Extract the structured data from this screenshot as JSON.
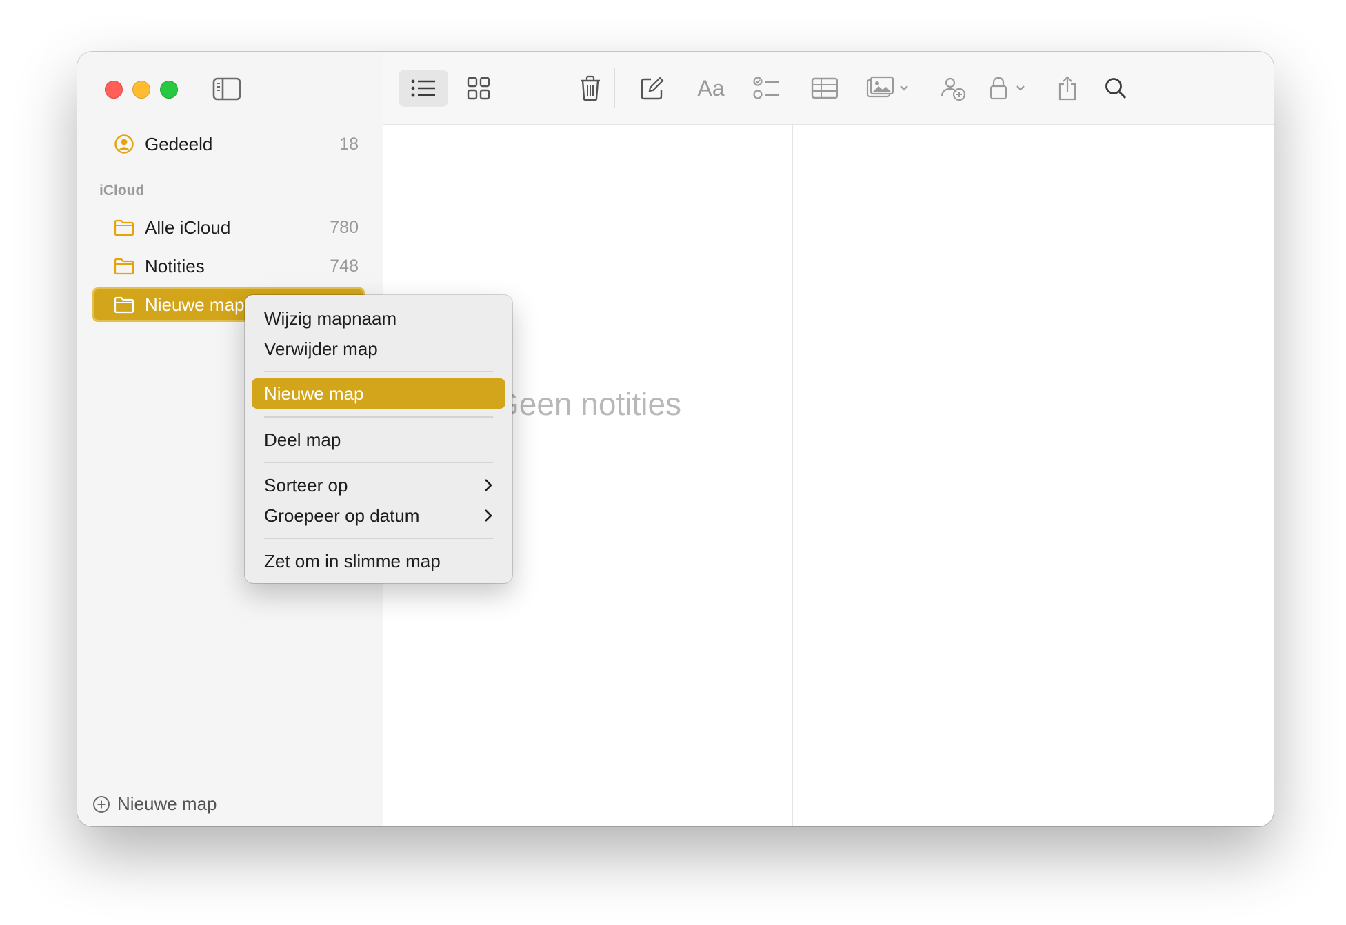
{
  "sidebar": {
    "shared": {
      "label": "Gedeeld",
      "count": "18"
    },
    "section_header": "iCloud",
    "folders": [
      {
        "label": "Alle iCloud",
        "count": "780"
      },
      {
        "label": "Notities",
        "count": "748"
      },
      {
        "label": "Nieuwe map",
        "count": ""
      }
    ],
    "new_folder_label": "Nieuwe map"
  },
  "toolbar": {
    "icons": [
      "list-view-icon",
      "gallery-view-icon",
      "trash-icon",
      "compose-icon",
      "format-text-icon",
      "checklist-icon",
      "table-icon",
      "media-icon",
      "collaborate-icon",
      "lock-icon",
      "share-icon",
      "search-icon"
    ],
    "format_label": "Aa"
  },
  "notes_list": {
    "empty_label": "Geen notities"
  },
  "context_menu": {
    "items": [
      {
        "label": "Wijzig mapnaam"
      },
      {
        "label": "Verwijder map"
      },
      {
        "label": "Nieuwe map"
      },
      {
        "label": "Deel map"
      },
      {
        "label": "Sorteer op"
      },
      {
        "label": "Groepeer op datum"
      },
      {
        "label": "Zet om in slimme map"
      }
    ]
  },
  "colors": {
    "accent": "#d2a51b",
    "folder_icon": "#e5a50a"
  }
}
